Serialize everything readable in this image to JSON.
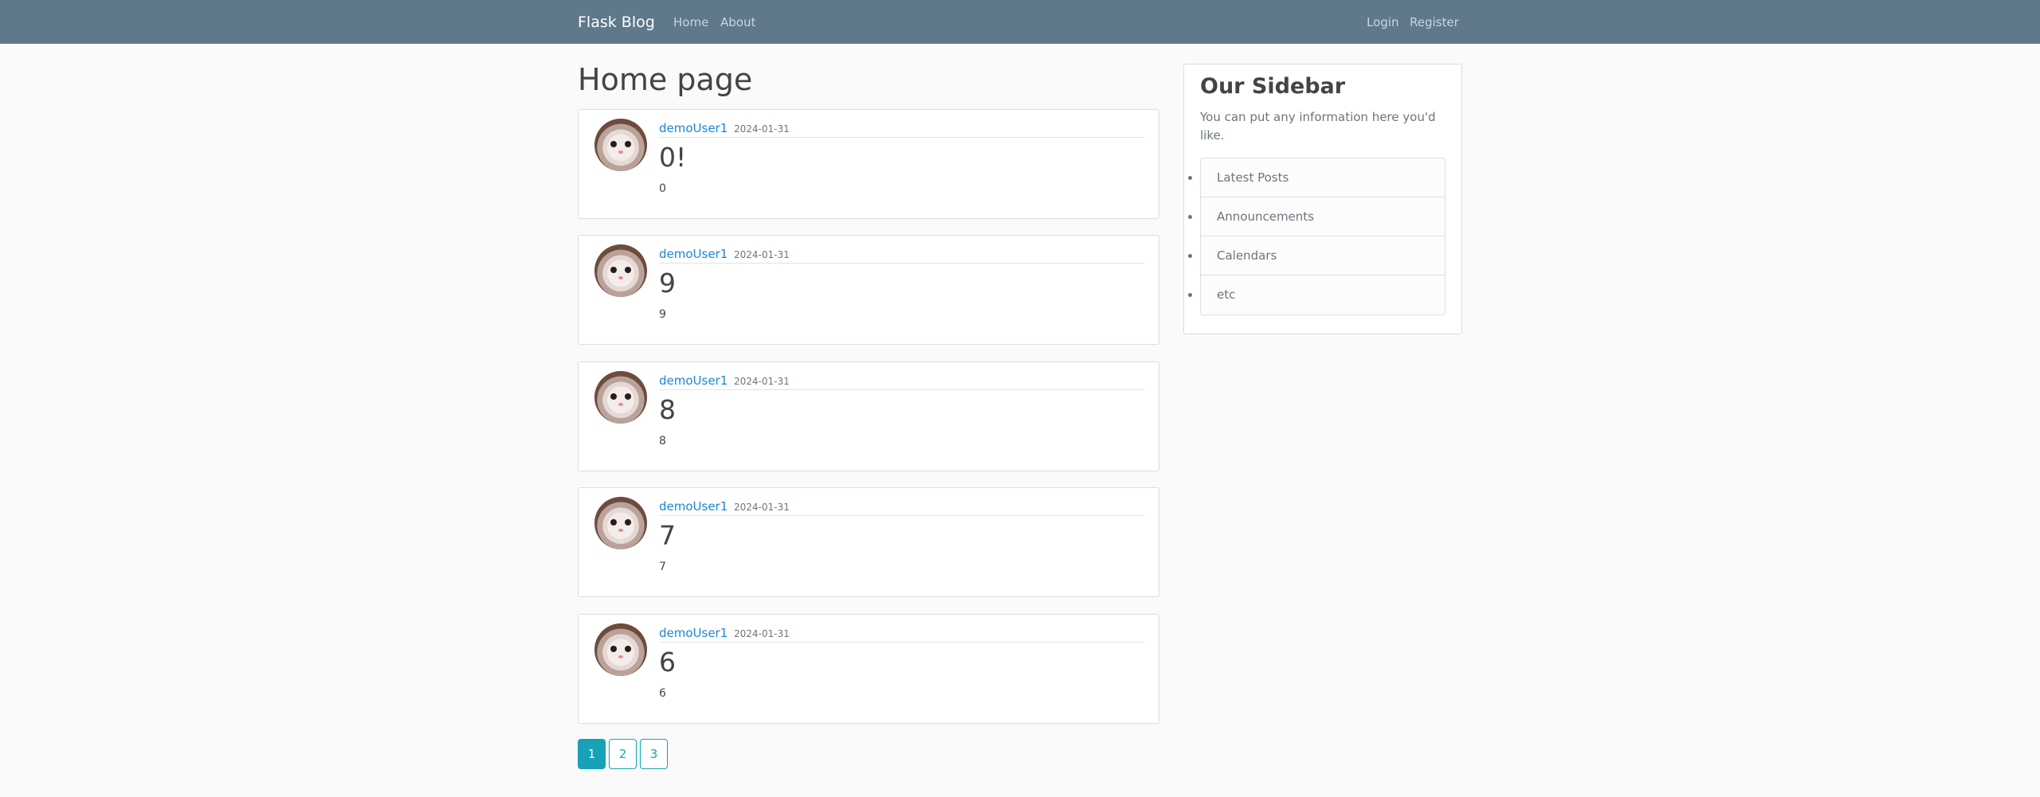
{
  "navbar": {
    "brand": "Flask Blog",
    "links": [
      "Home",
      "About"
    ],
    "auth_links": [
      "Login",
      "Register"
    ],
    "background": "#5f788a"
  },
  "main": {
    "title": "Home page",
    "posts": [
      {
        "author": "demoUser1",
        "date": "2024-01-31",
        "title": "0!",
        "content": "0"
      },
      {
        "author": "demoUser1",
        "date": "2024-01-31",
        "title": "9",
        "content": "9"
      },
      {
        "author": "demoUser1",
        "date": "2024-01-31",
        "title": "8",
        "content": "8"
      },
      {
        "author": "demoUser1",
        "date": "2024-01-31",
        "title": "7",
        "content": "7"
      },
      {
        "author": "demoUser1",
        "date": "2024-01-31",
        "title": "6",
        "content": "6"
      }
    ],
    "pagination": {
      "pages": [
        "1",
        "2",
        "3"
      ],
      "current": "1",
      "accent": "#17a2b8"
    }
  },
  "sidebar": {
    "title": "Our Sidebar",
    "description": "You can put any information here you'd like.",
    "items": [
      "Latest Posts",
      "Announcements",
      "Calendars",
      "etc"
    ]
  }
}
